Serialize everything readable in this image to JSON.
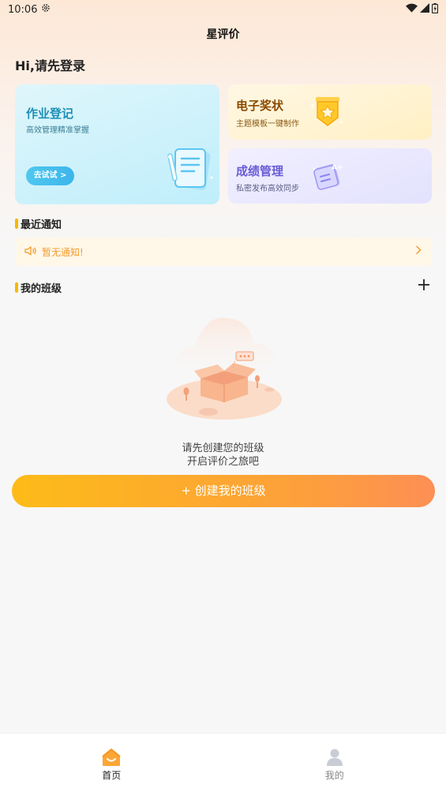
{
  "status_bar": {
    "time": "10:06"
  },
  "header": {
    "title": "星评价"
  },
  "greeting": "Hi,请先登录",
  "cards": {
    "homework": {
      "title": "作业登记",
      "subtitle": "高效管理精准掌握",
      "button": "去试试 >"
    },
    "award": {
      "title": "电子奖状",
      "subtitle": "主题模板一键制作"
    },
    "grade": {
      "title": "成绩管理",
      "subtitle": "私密发布高效同步"
    }
  },
  "notice_section": {
    "label": "最近通知",
    "empty_text": "暂无通知!"
  },
  "class_section": {
    "label": "我的班级"
  },
  "empty_state": {
    "line1": "请先创建您的班级",
    "line2": "开启评价之旅吧"
  },
  "create_button": {
    "label": "+ 创建我的班级"
  },
  "tabbar": {
    "items": [
      {
        "label": "首页",
        "icon": "home-icon",
        "active": true
      },
      {
        "label": "我的",
        "icon": "user-icon",
        "active": false
      }
    ]
  },
  "colors": {
    "accent": "#f9b800",
    "button_gradient": [
      "#fdbb18",
      "#fd8f55"
    ],
    "notice_text": "#f39b2b",
    "homework_title": "#1f8fb5",
    "award_title": "#8a4a00",
    "grade_title": "#6a5bd6"
  }
}
